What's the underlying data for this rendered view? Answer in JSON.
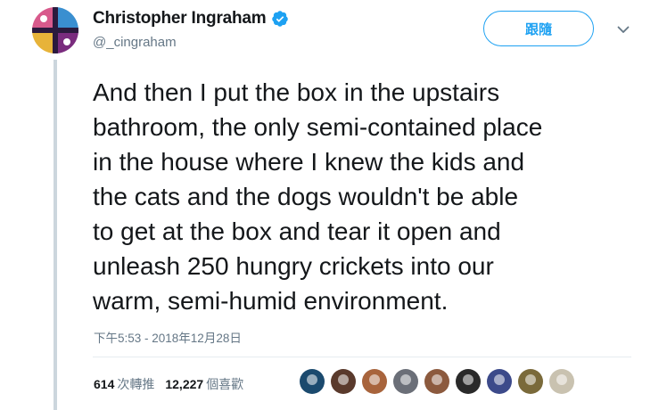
{
  "author": {
    "display_name": "Christopher Ingraham",
    "handle": "@_cingraham",
    "verified": true,
    "avatar_icon": "avatar-image"
  },
  "actions": {
    "follow_label": "跟隨",
    "menu_icon": "chevron-down-icon"
  },
  "tweet": {
    "lines": [
      "And then I put the box in the upstairs",
      "bathroom, the only semi-contained place",
      "in the house where I knew the kids and",
      "the cats and the dogs wouldn't be able",
      "to get at the box and tear it open and",
      "unleash 250 hungry crickets into our",
      "warm, semi-humid environment."
    ],
    "timestamp": "下午5:53 - 2018年12月28日"
  },
  "stats": {
    "retweets_count": "614",
    "retweets_label": "次轉推",
    "likes_count": "12,227",
    "likes_label": "個喜歡"
  },
  "likers": [
    {
      "color": "#1b4a6e"
    },
    {
      "color": "#5a3a2c"
    },
    {
      "color": "#a8643c"
    },
    {
      "color": "#6b6f78"
    },
    {
      "color": "#8c5a3e"
    },
    {
      "color": "#2a2a2a"
    },
    {
      "color": "#3c4a8a"
    },
    {
      "color": "#7a6a3a"
    },
    {
      "color": "#c9c2b0"
    }
  ],
  "colors": {
    "accent": "#1da1f2",
    "text": "#14171a",
    "secondary": "#657786"
  }
}
